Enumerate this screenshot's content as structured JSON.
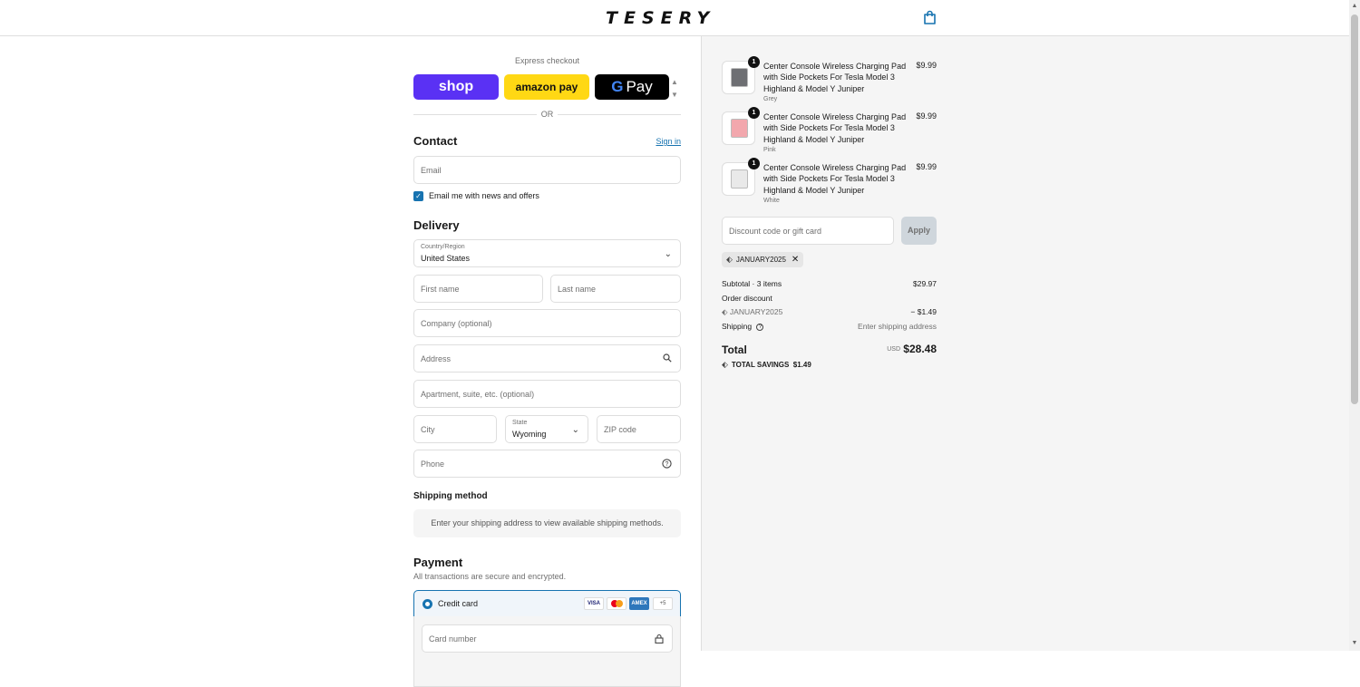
{
  "header": {
    "logo": "TESERY",
    "cart_icon": "shopping-bag-icon"
  },
  "express": {
    "label": "Express checkout",
    "shop_label": "shop",
    "amazon_label": "amazon pay",
    "gpay_g": "G",
    "gpay_label": "Pay",
    "or_label": "OR"
  },
  "contact": {
    "title": "Contact",
    "signin_label": "Sign in",
    "email_placeholder": "Email",
    "newsletter_label": "Email me with news and offers",
    "newsletter_checked": true
  },
  "delivery": {
    "title": "Delivery",
    "country_label": "Country/Region",
    "country_value": "United States",
    "first_name_placeholder": "First name",
    "last_name_placeholder": "Last name",
    "company_placeholder": "Company (optional)",
    "address_placeholder": "Address",
    "apartment_placeholder": "Apartment, suite, etc. (optional)",
    "city_placeholder": "City",
    "state_label": "State",
    "state_value": "Wyoming",
    "zip_placeholder": "ZIP code",
    "phone_placeholder": "Phone"
  },
  "shipping_method": {
    "title": "Shipping method",
    "message": "Enter your shipping address to view available shipping methods."
  },
  "payment": {
    "title": "Payment",
    "subtitle": "All transactions are secure and encrypted.",
    "credit_card_label": "Credit card",
    "visa_label": "VISA",
    "amex_label": "AMEX",
    "more_cards_label": "+5",
    "card_number_placeholder": "Card number"
  },
  "summary": {
    "items": [
      {
        "title": "Center Console Wireless Charging Pad with Side Pockets For Tesla Model 3 Highland & Model Y Juniper",
        "variant": "Grey",
        "price": "$9.99",
        "qty": "1",
        "color": "#6e6f73"
      },
      {
        "title": "Center Console Wireless Charging Pad with Side Pockets For Tesla Model 3 Highland & Model Y Juniper",
        "variant": "Pink",
        "price": "$9.99",
        "qty": "1",
        "color": "#f2a7ad"
      },
      {
        "title": "Center Console Wireless Charging Pad with Side Pockets For Tesla Model 3 Highland & Model Y Juniper",
        "variant": "White",
        "price": "$9.99",
        "qty": "1",
        "color": "#e9e9e9"
      }
    ],
    "discount_placeholder": "Discount code or gift card",
    "apply_label": "Apply",
    "applied_code": "JANUARY2025",
    "subtotal_label": "Subtotal · 3 items",
    "subtotal_value": "$29.97",
    "order_discount_label": "Order discount",
    "discount_code": "JANUARY2025",
    "discount_value": "− $1.49",
    "shipping_label": "Shipping",
    "shipping_value": "Enter shipping address",
    "total_label": "Total",
    "total_currency": "USD",
    "total_value": "$28.48",
    "savings_label": "TOTAL SAVINGS",
    "savings_value": "$1.49"
  },
  "colors": {
    "accent": "#1773b0",
    "shop": "#5a31f4",
    "amazon": "#ffd814"
  }
}
